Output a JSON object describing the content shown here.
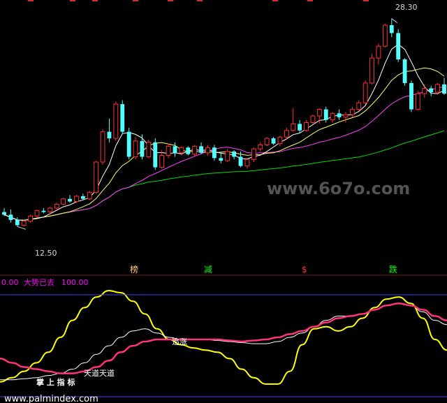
{
  "chart_data": [
    {
      "type": "candlestick",
      "title": "",
      "ylim": [
        10.5,
        29.5
      ],
      "grid": false,
      "colors": {
        "up": "#ff3030",
        "down": "#54ffff",
        "ma5": "#ffffff",
        "ma10": "#ffff60",
        "ma20": "#ff40ff",
        "ma60": "#00dd00"
      },
      "annotations": {
        "high": "28.30",
        "low": "12.50"
      },
      "markers": [
        {
          "text": "榜",
          "color": "#ffcc66"
        },
        {
          "text": "减",
          "color": "#00ff00"
        },
        {
          "text": "$",
          "color": "#ff3030"
        },
        {
          "text": "跌",
          "color": "#00ff00"
        }
      ],
      "candles": [
        [
          13.6,
          13.9,
          13.3,
          13.4
        ],
        [
          13.4,
          13.8,
          12.8,
          13.0
        ],
        [
          13.0,
          13.2,
          12.5,
          12.6
        ],
        [
          12.6,
          13.0,
          12.5,
          12.9
        ],
        [
          12.9,
          13.4,
          12.8,
          13.3
        ],
        [
          13.3,
          13.8,
          13.2,
          13.7
        ],
        [
          13.7,
          13.9,
          13.5,
          13.6
        ],
        [
          13.6,
          14.0,
          13.4,
          13.9
        ],
        [
          13.9,
          14.3,
          13.8,
          14.2
        ],
        [
          14.2,
          14.7,
          14.1,
          14.6
        ],
        [
          14.6,
          14.9,
          14.3,
          14.4
        ],
        [
          14.4,
          14.9,
          14.3,
          14.8
        ],
        [
          14.8,
          15.0,
          14.5,
          14.6
        ],
        [
          14.6,
          15.2,
          14.5,
          15.1
        ],
        [
          15.1,
          17.5,
          15.0,
          17.4
        ],
        [
          17.4,
          19.9,
          17.2,
          19.7
        ],
        [
          19.7,
          20.7,
          18.9,
          19.2
        ],
        [
          19.2,
          22.0,
          19.0,
          21.8
        ],
        [
          21.8,
          22.1,
          19.5,
          19.7
        ],
        [
          19.7,
          20.0,
          17.6,
          17.8
        ],
        [
          17.8,
          19.3,
          17.6,
          19.0
        ],
        [
          19.0,
          19.5,
          17.6,
          17.8
        ],
        [
          17.8,
          19.1,
          17.7,
          18.9
        ],
        [
          18.9,
          19.2,
          16.8,
          17.0
        ],
        [
          17.0,
          18.3,
          16.9,
          17.9
        ],
        [
          17.9,
          18.8,
          17.7,
          18.6
        ],
        [
          18.6,
          18.9,
          17.8,
          18.1
        ],
        [
          18.1,
          18.6,
          17.9,
          18.5
        ],
        [
          18.5,
          18.6,
          17.9,
          18.0
        ],
        [
          18.0,
          18.7,
          17.8,
          18.6
        ],
        [
          18.6,
          18.9,
          18.0,
          18.1
        ],
        [
          18.1,
          18.7,
          17.9,
          18.5
        ],
        [
          18.5,
          18.7,
          17.5,
          17.7
        ],
        [
          17.7,
          18.1,
          17.3,
          17.5
        ],
        [
          17.5,
          18.4,
          17.4,
          18.2
        ],
        [
          18.2,
          18.3,
          17.6,
          17.8
        ],
        [
          17.8,
          18.2,
          17.0,
          17.1
        ],
        [
          17.1,
          17.7,
          16.9,
          17.6
        ],
        [
          17.6,
          18.5,
          17.4,
          18.4
        ],
        [
          18.4,
          18.9,
          18.2,
          18.7
        ],
        [
          18.7,
          19.3,
          18.6,
          19.2
        ],
        [
          19.2,
          19.3,
          18.7,
          18.8
        ],
        [
          18.8,
          19.4,
          18.6,
          19.3
        ],
        [
          19.3,
          20.0,
          19.1,
          19.8
        ],
        [
          19.8,
          21.5,
          19.7,
          20.3
        ],
        [
          20.3,
          20.6,
          19.6,
          19.8
        ],
        [
          19.8,
          20.6,
          19.7,
          20.4
        ],
        [
          20.4,
          21.0,
          20.3,
          20.9
        ],
        [
          20.9,
          21.5,
          20.3,
          21.4
        ],
        [
          21.4,
          21.6,
          20.4,
          20.6
        ],
        [
          20.6,
          21.2,
          20.4,
          21.1
        ],
        [
          21.1,
          21.4,
          20.6,
          20.8
        ],
        [
          20.8,
          21.2,
          20.4,
          21.0
        ],
        [
          21.0,
          21.6,
          20.8,
          21.4
        ],
        [
          21.4,
          22.1,
          21.3,
          21.9
        ],
        [
          21.9,
          23.6,
          21.8,
          23.4
        ],
        [
          23.4,
          25.6,
          23.3,
          25.3
        ],
        [
          25.3,
          26.4,
          24.8,
          26.2
        ],
        [
          26.2,
          27.9,
          26.1,
          27.8
        ],
        [
          27.8,
          28.3,
          26.9,
          27.2
        ],
        [
          27.2,
          27.5,
          25.0,
          25.2
        ],
        [
          25.2,
          25.3,
          23.2,
          23.4
        ],
        [
          23.4,
          23.6,
          21.2,
          21.4
        ],
        [
          21.4,
          22.8,
          21.3,
          22.6
        ],
        [
          22.6,
          23.3,
          22.3,
          23.0
        ],
        [
          23.0,
          23.2,
          22.4,
          22.7
        ],
        [
          22.7,
          23.4,
          22.5,
          23.3
        ],
        [
          23.3,
          23.8,
          22.5,
          22.6
        ]
      ]
    },
    {
      "type": "line",
      "ylim": [
        0,
        100
      ],
      "legend_values": {
        "first": "0.00",
        "label": "大势已去",
        "second": "100.00"
      },
      "annotations": [
        {
          "text": "追涨",
          "color": "#ffffff"
        },
        {
          "text": "天道天道",
          "color": "#ffffff"
        },
        {
          "text": "掌 上 指 标",
          "color": "#ffffff"
        }
      ],
      "series": [
        {
          "color": "#ffff00",
          "values": [
            10,
            14,
            20,
            28,
            38,
            52,
            68,
            80,
            90,
            96,
            94,
            86,
            74,
            60,
            50,
            45,
            42,
            40,
            38,
            32,
            22,
            14,
            8,
            8,
            20,
            45,
            60,
            62,
            58,
            62,
            70,
            80,
            88,
            90,
            84,
            70,
            50,
            40
          ]
        },
        {
          "color": "#ffffff",
          "values": [
            12,
            12,
            13,
            14,
            16,
            18,
            22,
            28,
            36,
            44,
            52,
            58,
            60,
            56,
            52,
            50,
            50,
            50,
            49,
            48,
            47,
            46,
            46,
            48,
            52,
            56,
            62,
            68,
            72,
            72,
            74,
            78,
            82,
            84,
            82,
            76,
            68,
            64
          ]
        },
        {
          "color": "#ff3377",
          "values": [
            32,
            28,
            24,
            22,
            20,
            18,
            18,
            20,
            24,
            30,
            38,
            44,
            48,
            50,
            50,
            50,
            50,
            50,
            50,
            49,
            48,
            49,
            50,
            52,
            55,
            58,
            62,
            66,
            70,
            72,
            74,
            78,
            82,
            84,
            82,
            78,
            72,
            68
          ]
        }
      ]
    }
  ],
  "footer": {
    "watermark": "www.palmindex.com",
    "overlay_watermark": "www.6o7o.com"
  }
}
